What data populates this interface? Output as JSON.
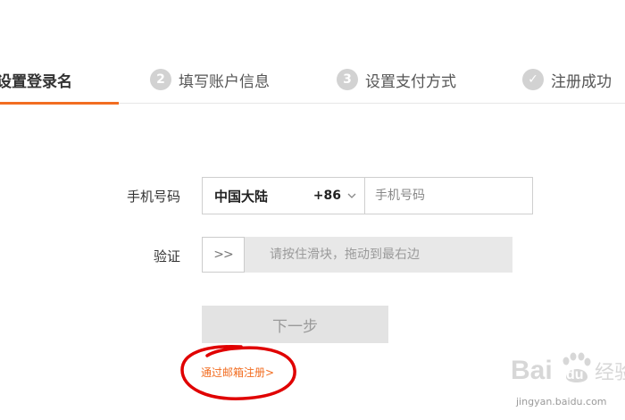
{
  "steps": [
    {
      "number": "",
      "label": "设置登录名",
      "active": true
    },
    {
      "number": "2",
      "label": "填写账户信息",
      "active": false
    },
    {
      "number": "3",
      "label": "设置支付方式",
      "active": false
    },
    {
      "number": "✓",
      "label": "注册成功",
      "active": false
    }
  ],
  "form": {
    "phone_label": "手机号码",
    "region": "中国大陆",
    "country_code": "+86",
    "phone_placeholder": "手机号码",
    "verify_label": "验证",
    "slider_handle": ">>",
    "slider_hint": "请按住滑块，拖动到最右边",
    "next_button": "下一步",
    "email_link": "通过邮箱注册>"
  },
  "watermark": {
    "brand": "Bai du 经验",
    "url": "jingyan.baidu.com"
  },
  "colors": {
    "accent": "#f26d21",
    "annotation": "#e00000"
  }
}
